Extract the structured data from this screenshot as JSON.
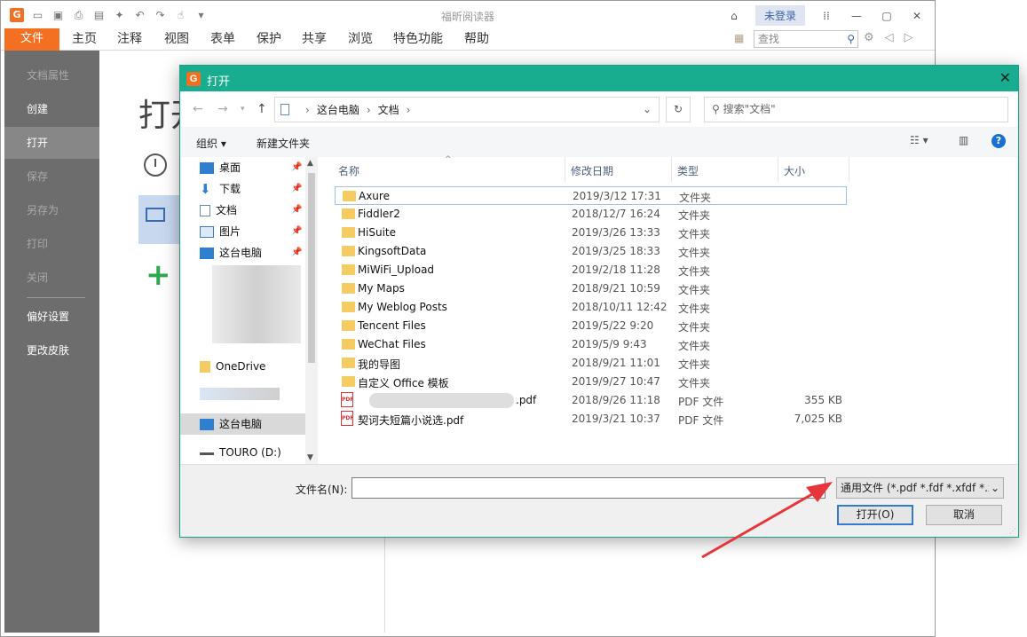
{
  "app": {
    "title": "福昕阅读器",
    "login": "未登录",
    "file_tab": "文件",
    "ribbon_tabs": [
      "主页",
      "注释",
      "视图",
      "表单",
      "保护",
      "共享",
      "浏览",
      "特色功能",
      "帮助"
    ],
    "search_placeholder": "查找"
  },
  "sidebar": {
    "items": [
      {
        "label": "文档属性",
        "state": "dim"
      },
      {
        "label": "创建",
        "state": "normal"
      },
      {
        "label": "打开",
        "state": "active"
      },
      {
        "label": "保存",
        "state": "dim"
      },
      {
        "label": "另存为",
        "state": "dim"
      },
      {
        "label": "打印",
        "state": "dim"
      },
      {
        "label": "关闭",
        "state": "dim"
      },
      {
        "label": "偏好设置",
        "state": "normal"
      },
      {
        "label": "更改皮肤",
        "state": "normal"
      }
    ]
  },
  "content": {
    "title": "打开"
  },
  "dialog": {
    "title": "打开",
    "breadcrumb": [
      "这台电脑",
      "文档"
    ],
    "search_placeholder": "搜索\"文档\"",
    "organize": "组织",
    "new_folder": "新建文件夹",
    "tree": {
      "quick": [
        "桌面",
        "下载",
        "文档",
        "图片",
        "这台电脑"
      ],
      "onedrive": "OneDrive",
      "thispc": "这台电脑",
      "drive": "TOURO (D:)"
    },
    "columns": {
      "name": "名称",
      "date": "修改日期",
      "type": "类型",
      "size": "大小"
    },
    "files": [
      {
        "name": "Axure",
        "date": "2019/3/12 17:31",
        "type": "文件夹",
        "size": "",
        "kind": "folder"
      },
      {
        "name": "Fiddler2",
        "date": "2018/12/7 16:24",
        "type": "文件夹",
        "size": "",
        "kind": "folder"
      },
      {
        "name": "HiSuite",
        "date": "2019/3/26 13:33",
        "type": "文件夹",
        "size": "",
        "kind": "folder"
      },
      {
        "name": "KingsoftData",
        "date": "2019/3/25 18:33",
        "type": "文件夹",
        "size": "",
        "kind": "folder"
      },
      {
        "name": "MiWiFi_Upload",
        "date": "2019/2/18 11:28",
        "type": "文件夹",
        "size": "",
        "kind": "folder"
      },
      {
        "name": "My Maps",
        "date": "2018/9/21 10:59",
        "type": "文件夹",
        "size": "",
        "kind": "folder"
      },
      {
        "name": "My Weblog Posts",
        "date": "2018/10/11 12:42",
        "type": "文件夹",
        "size": "",
        "kind": "folder"
      },
      {
        "name": "Tencent Files",
        "date": "2019/5/22 9:20",
        "type": "文件夹",
        "size": "",
        "kind": "folder"
      },
      {
        "name": "WeChat Files",
        "date": "2019/5/9 9:43",
        "type": "文件夹",
        "size": "",
        "kind": "folder"
      },
      {
        "name": "我的导图",
        "date": "2018/9/21 11:01",
        "type": "文件夹",
        "size": "",
        "kind": "folder"
      },
      {
        "name": "自定义 Office 模板",
        "date": "2019/9/27 10:47",
        "type": "文件夹",
        "size": "",
        "kind": "folder"
      },
      {
        "name": ".pdf",
        "date": "2018/9/26 11:18",
        "type": "PDF 文件",
        "size": "355 KB",
        "kind": "pdf-blur"
      },
      {
        "name": "契诃夫短篇小说选.pdf",
        "date": "2019/3/21 10:37",
        "type": "PDF 文件",
        "size": "7,025 KB",
        "kind": "pdf"
      }
    ],
    "filename_label": "文件名(N):",
    "filename_value": "",
    "filetype": "通用文件 (*.pdf *.fdf *.xfdf *.x",
    "open_btn": "打开(O)",
    "cancel_btn": "取消"
  },
  "colors": {
    "brand": "#f37022",
    "dialog_title": "#18ad8e",
    "arrow": "#e8353b"
  }
}
